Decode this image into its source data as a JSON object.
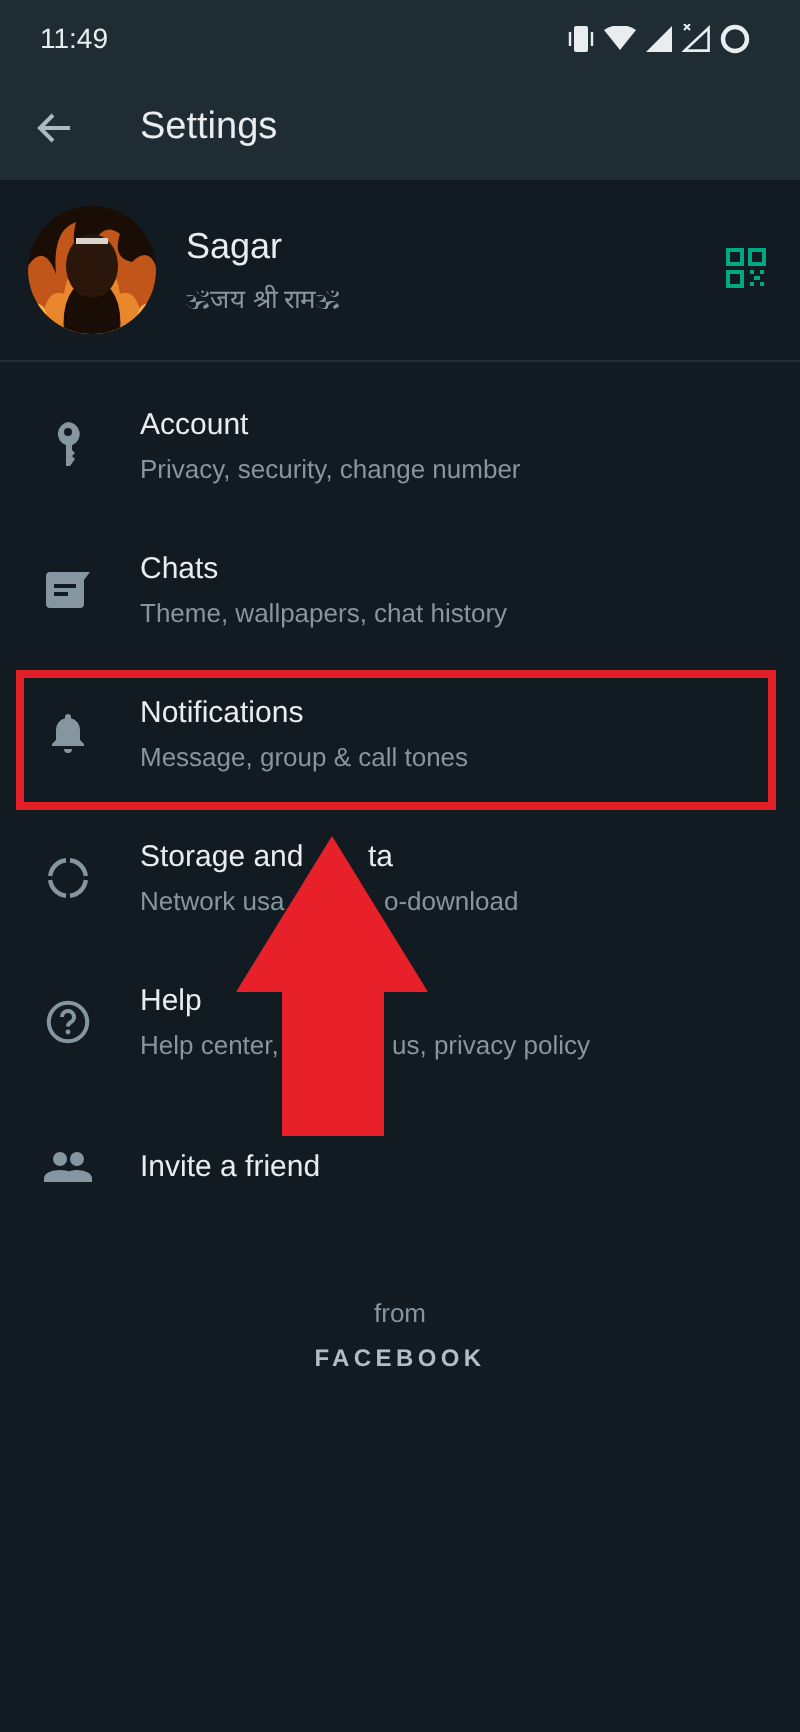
{
  "status_bar": {
    "time": "11:49"
  },
  "toolbar": {
    "title": "Settings"
  },
  "profile": {
    "name": "Sagar",
    "about": "🕉जय श्री राम🕉"
  },
  "items": [
    {
      "title_parts": [
        "Account"
      ],
      "subtitle_parts": [
        "Privacy, security, change number"
      ]
    },
    {
      "title_parts": [
        "Chats"
      ],
      "subtitle_parts": [
        "Theme, wallpapers, chat history"
      ]
    },
    {
      "title_parts": [
        "Notifications"
      ],
      "subtitle_parts": [
        "Message, group & call tones"
      ]
    },
    {
      "title_parts": [
        "Storage and",
        "ta"
      ],
      "subtitle_parts": [
        "Network usa",
        "o-download"
      ]
    },
    {
      "title_parts": [
        "Help"
      ],
      "subtitle_parts": [
        "Help center,",
        "us, privacy policy"
      ]
    },
    {
      "title_parts": [
        "Invite a friend"
      ]
    }
  ],
  "footer": {
    "from": "from",
    "brand": "FACEBOOK"
  },
  "annotations": {
    "highlight_box": true,
    "arrow": true
  }
}
